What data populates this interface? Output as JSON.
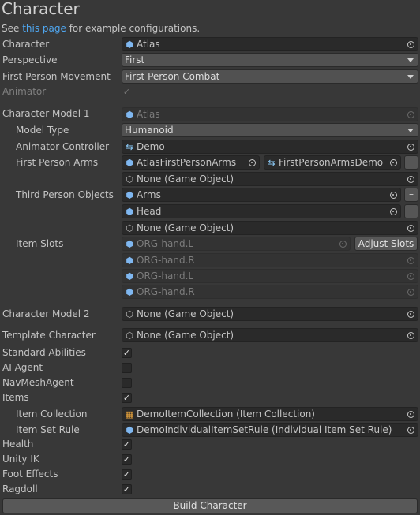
{
  "header": {
    "title": "Character",
    "see_prefix": "See ",
    "see_link": "this page",
    "see_suffix": " for example configurations."
  },
  "rows": {
    "character": {
      "label": "Character",
      "value": "Atlas"
    },
    "perspective": {
      "label": "Perspective",
      "value": "First"
    },
    "fp_movement": {
      "label": "First Person Movement",
      "value": "First Person Combat"
    },
    "animator": {
      "label": "Animator",
      "checked": true
    }
  },
  "model1": {
    "label": "Character Model 1",
    "value": "Atlas",
    "model_type": {
      "label": "Model Type",
      "value": "Humanoid"
    },
    "animator_controller": {
      "label": "Animator Controller",
      "value": "Demo"
    },
    "first_person_arms": {
      "label": "First Person Arms",
      "value": "AtlasFirstPersonArms",
      "controller": "FirstPersonArmsDemo",
      "empty": "None (Game Object)"
    },
    "third_person_objects": {
      "label": "Third Person Objects",
      "items": [
        "Arms",
        "Head"
      ],
      "empty": "None (Game Object)"
    },
    "item_slots": {
      "label": "Item Slots",
      "items": [
        "ORG-hand.L",
        "ORG-hand.R",
        "ORG-hand.L",
        "ORG-hand.R"
      ],
      "button": "Adjust Slots"
    }
  },
  "model2": {
    "label": "Character Model 2",
    "value": "None (Game Object)"
  },
  "template": {
    "label": "Template Character",
    "value": "None (Game Object)"
  },
  "toggles": [
    {
      "label": "Standard Abilities",
      "checked": true
    },
    {
      "label": "AI Agent",
      "checked": false
    },
    {
      "label": "NavMeshAgent",
      "checked": false
    },
    {
      "label": "Items",
      "checked": true
    }
  ],
  "items": {
    "item_collection": {
      "label": "Item Collection",
      "value": "DemoItemCollection (Item Collection)"
    },
    "item_set_rule": {
      "label": "Item Set Rule",
      "value": "DemoIndividualItemSetRule (Individual Item Set Rule)"
    }
  },
  "toggles2": [
    {
      "label": "Health",
      "checked": true
    },
    {
      "label": "Unity IK",
      "checked": true
    },
    {
      "label": "Foot Effects",
      "checked": true
    },
    {
      "label": "Ragdoll",
      "checked": true
    }
  ],
  "build_button": "Build Character",
  "glyphs": {
    "check": "✓",
    "minus": "–",
    "prefab": "⬢",
    "gameobject": "⬡",
    "controller": "⇆",
    "collection": "▦"
  },
  "colors": {
    "background": "#383838",
    "link": "#4fa6ef",
    "field": "#2a2a2a",
    "button": "#585858"
  }
}
